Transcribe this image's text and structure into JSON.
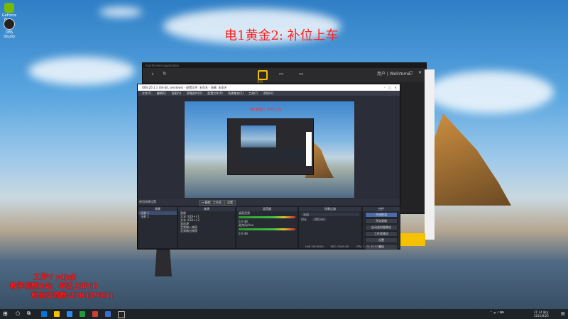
{
  "overlay": {
    "title": "电1黄金2: 补位上车",
    "watermark": [
      "工作V ydjsjl",
      "教学视频B站：年迈上单YD",
      "粉丝交流群:230459531"
    ]
  },
  "desktop_icons": [
    {
      "label": "GeForce Exp..."
    },
    {
      "label": "OBS Studio"
    }
  ],
  "app_window": {
    "title": "Fourth-level application",
    "home_label": "主页",
    "user_label": "用户 | Wellcome"
  },
  "obs": {
    "title": "OBS 26.1.1 (64-bit, windows) - 配置文件: 未命名 - 场景: 未命名",
    "menu": [
      "文件(F)",
      "编辑(E)",
      "视图(V)",
      "停靠部件(D)",
      "配置文件(P)",
      "场景集合(S)",
      "工具(T)",
      "帮助(H)"
    ],
    "preview_title": "电1黄金2: 补位上车",
    "mode_buttons": [
      "↔ 翻转",
      "工作室",
      "设置"
    ],
    "left_label": "使用场景设置",
    "docks": {
      "scenes_header": "场景",
      "scenes": [
        "场景 1",
        "场景 2"
      ],
      "sources_header": "来源",
      "sources": [
        "图像",
        "文本 (GDI+) 1",
        "文本 (GDI+) 2",
        "游戏源",
        "音频输入捕获",
        "音频输出捕获"
      ],
      "mixer_header": "混音器",
      "mixer": [
        {
          "name": "桌面音频",
          "db": "0.0 dB"
        },
        {
          "name": "麦克风/Aux",
          "db": "0.0 dB"
        }
      ],
      "transitions_header": "场景过渡",
      "transition_type": "淡出",
      "duration_label": "时长",
      "duration_value": "300 ms",
      "controls_header": "控件",
      "controls": [
        "开始推流",
        "开始录制",
        "启动虚拟摄像机",
        "工作室模式",
        "设置",
        "退出"
      ]
    },
    "status": {
      "live": "LIVE: 00:00:00",
      "rec": "REC: 00:00:00",
      "cpu": "CPU: 1.1%, 60.00 fps"
    }
  },
  "taskbar": {
    "time": "21:14 周五",
    "date": "2021/8/20"
  },
  "colors": {
    "overlay_red": "#ff2020",
    "obs_bg": "#2b2e38",
    "accent_yellow": "#f4c000"
  }
}
